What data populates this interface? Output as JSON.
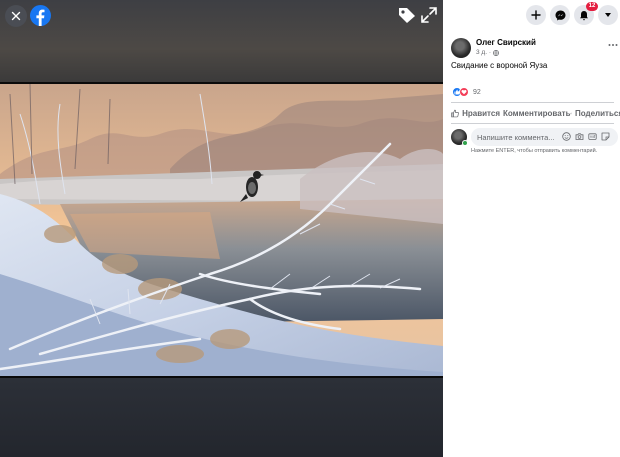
{
  "viewer": {
    "close_icon": "close-icon",
    "logo_icon": "facebook-logo",
    "tag_icon": "tag-icon",
    "fullscreen_icon": "expand-icon"
  },
  "topbar": {
    "create_icon": "plus-icon",
    "messenger_icon": "messenger-icon",
    "notifications_icon": "bell-icon",
    "notifications_count": "12",
    "account_icon": "caret-down-icon",
    "badge_color": "#e41e3f"
  },
  "post": {
    "author": "Олег Свирский",
    "time": "3 д. ·",
    "privacy_icon": "globe-icon",
    "text": "Свидание с вороной Яуза",
    "reaction_count": "92",
    "more_icon": "more-horizontal-icon"
  },
  "actions": {
    "like": "Нравится",
    "comment": "Комментировать",
    "share": "Поделиться"
  },
  "comment": {
    "placeholder": "Напишите коммента...",
    "hint": "Нажмите ENTER, чтобы отправить комментарий."
  },
  "colors": {
    "brand": "#1877f2",
    "love": "#f33e58",
    "online": "#31a24c"
  }
}
